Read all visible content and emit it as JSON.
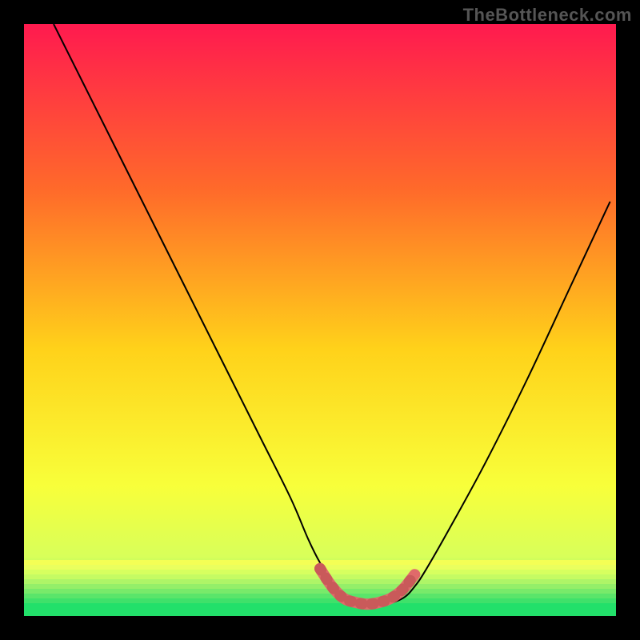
{
  "watermark": "TheBottleneck.com",
  "colors": {
    "frame": "#000000",
    "grad_top": "#ff1a4f",
    "grad_mid1": "#ff6a2a",
    "grad_mid2": "#ffd21a",
    "grad_mid3": "#f8ff3a",
    "grad_mid4": "#d8ff5a",
    "grad_bottom": "#22e06a",
    "curve": "#000000",
    "bottom_highlight": "#e06a6a"
  },
  "chart_data": {
    "type": "line",
    "title": "",
    "xlabel": "",
    "ylabel": "",
    "xlim": [
      0,
      100
    ],
    "ylim": [
      0,
      100
    ],
    "note": "Axis values are relative (no tick labels in source). Curve is a bottleneck V-shape with a flat basin centered near x≈58.",
    "series": [
      {
        "name": "bottleneck-curve",
        "x": [
          5,
          10,
          15,
          20,
          25,
          30,
          35,
          40,
          45,
          48,
          50,
          52,
          55,
          58,
          61,
          64,
          66,
          68,
          72,
          78,
          85,
          92,
          99
        ],
        "y": [
          100,
          90,
          80,
          70,
          60,
          50,
          40,
          30,
          20,
          13,
          9,
          6,
          3,
          2,
          2,
          3,
          5,
          8,
          15,
          26,
          40,
          55,
          70
        ]
      },
      {
        "name": "basin-highlight",
        "x": [
          50,
          52,
          54,
          56,
          58,
          60,
          62,
          64,
          66
        ],
        "y": [
          8,
          5,
          3,
          2.3,
          2,
          2.3,
          3,
          4.5,
          7
        ]
      }
    ]
  }
}
